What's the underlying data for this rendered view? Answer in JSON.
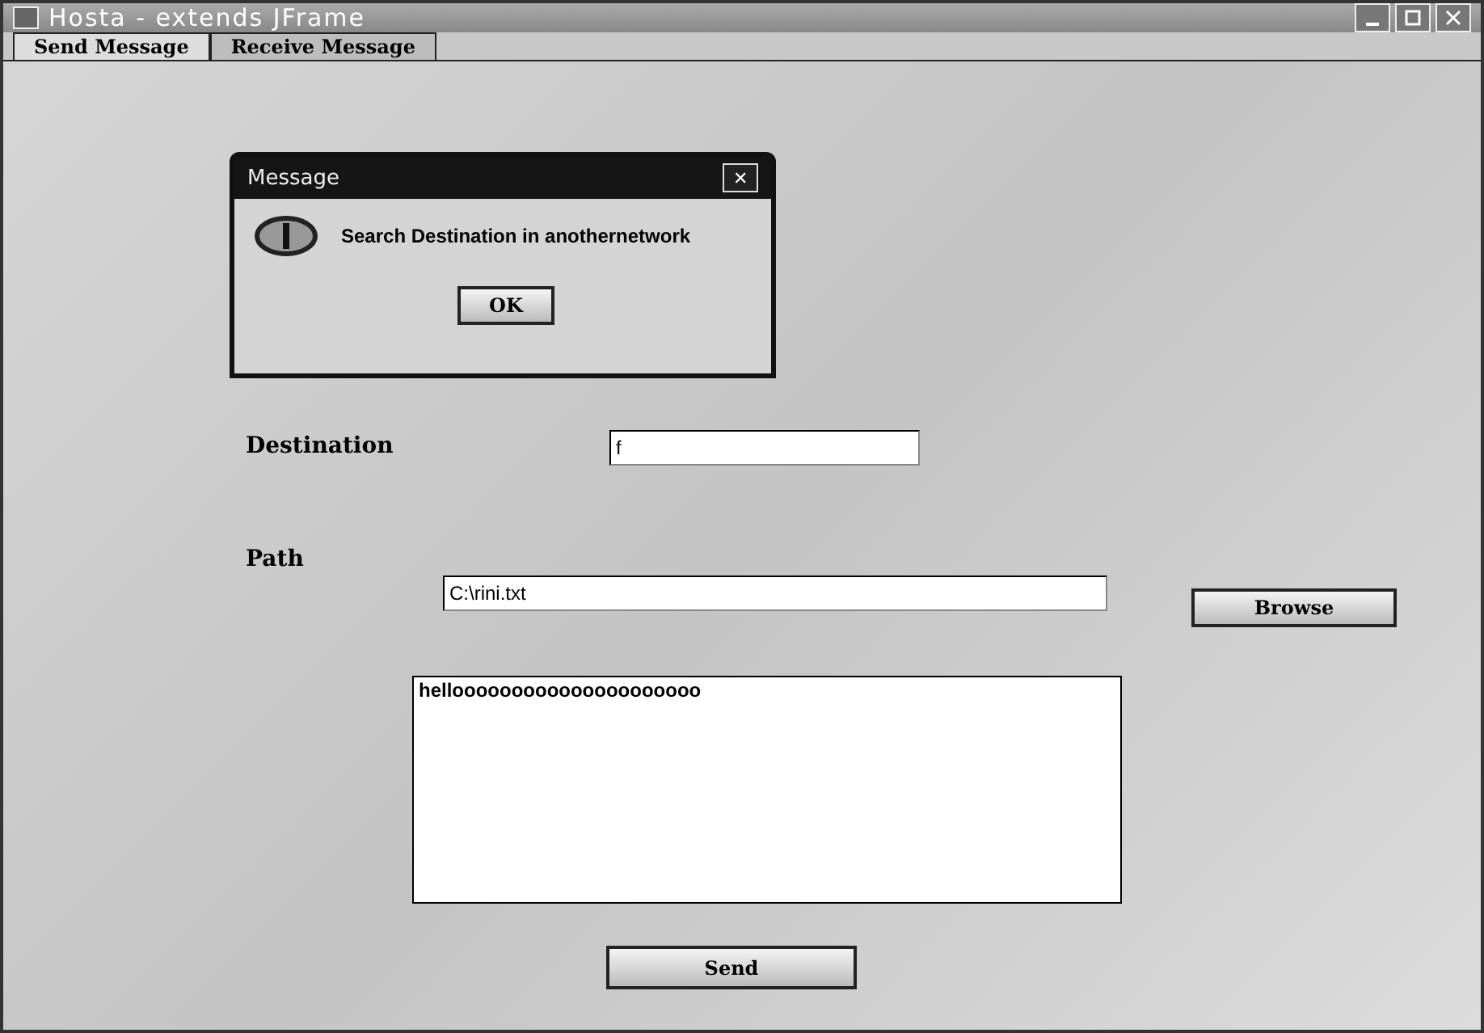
{
  "window": {
    "title": "Hosta - extends JFrame"
  },
  "tabs": [
    {
      "label": "Send Message",
      "selected": true
    },
    {
      "label": "Receive Message",
      "selected": false
    }
  ],
  "form": {
    "destination_label": "Destination",
    "destination_value": "f",
    "path_label": "Path",
    "path_value": "C:\\rini.txt",
    "browse_button": "Browse",
    "message_value": "hellooooooooooooooooooooo",
    "send_button": "Send"
  },
  "dialog": {
    "title": "Message",
    "close": "✕",
    "text": "Search Destination in anothernetwork",
    "ok_button": "OK"
  }
}
